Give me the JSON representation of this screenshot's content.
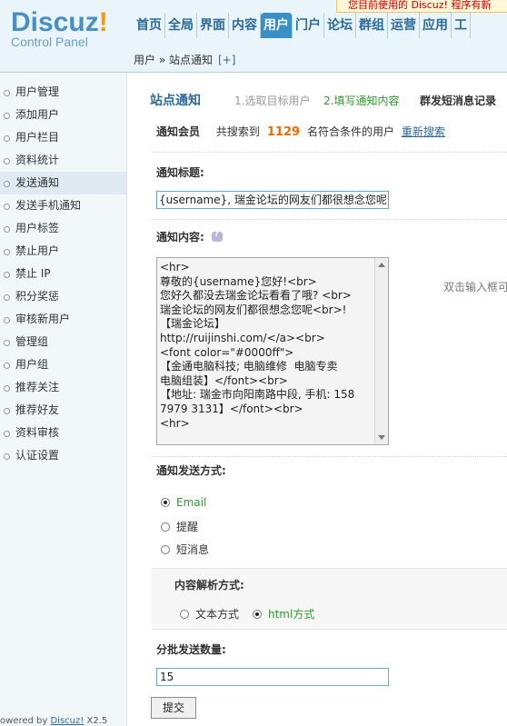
{
  "header": {
    "logo": "Discuz",
    "logo_bang": "!",
    "logo_sub": "Control Panel",
    "notice": "您目前使用的 Discuz! 程序有新",
    "nav": [
      "首页",
      "全局",
      "界面",
      "内容",
      "用户",
      "门户",
      "论坛",
      "群组",
      "运营",
      "应用",
      "工"
    ],
    "nav_active_index": 4,
    "breadcrumb": "用户 » 站点通知",
    "breadcrumb_plus": "[+]"
  },
  "sidebar": {
    "items": [
      "用户管理",
      "添加用户",
      "用户栏目",
      "资料统计",
      "发送通知",
      "发送手机通知",
      "用户标签",
      "禁止用户",
      "禁止 IP",
      "积分奖惩",
      "审核新用户",
      "管理组",
      "用户组",
      "推荐关注",
      "推荐好友",
      "资料审核",
      "认证设置"
    ],
    "active_index": 4,
    "footer_prefix": "owered by",
    "footer_brand": "Discuz!",
    "footer_version": "X2.5"
  },
  "main": {
    "title": "站点通知",
    "step1": "1.选取目标用户",
    "step2": "2.填写通知内容",
    "step3": "群发短消息记录",
    "members_label": "通知会员",
    "members_prefix": "共搜索到",
    "members_count": "1129",
    "members_suffix": "名符合条件的用户",
    "research_link": "重新搜索",
    "subject_label": "通知标题:",
    "subject_value": "{username}, 瑞金论坛的网友们都很想念您呢",
    "content_label": "通知内容:",
    "content_value": "<hr>\n尊敬的{username}您好!<br>\n您好久都没去瑞金论坛看看了哦? <br>\n瑞金论坛的网友们都很想念您呢<br>!\n【瑞金论坛】\nhttp://ruijinshi.com/</a><br>\n<font color=\"#0000ff\">\n【金通电脑科技; 电脑维修  电脑专卖\n电脑组装】</font><br>\n【地址: 瑞金市向阳南路中段, 手机: 158\n7979 3131】</font><br>\n<hr>",
    "dblclick_hint": "双击输入框可",
    "send_method_label": "通知发送方式:",
    "send_methods": [
      "Email",
      "提醒",
      "短消息"
    ],
    "send_method_selected": 0,
    "parse_label": "内容解析方式:",
    "parse_options": [
      "文本方式",
      "html方式"
    ],
    "parse_selected": 1,
    "batch_label": "分批发送数量:",
    "batch_value": "15",
    "submit_label": "提交"
  }
}
